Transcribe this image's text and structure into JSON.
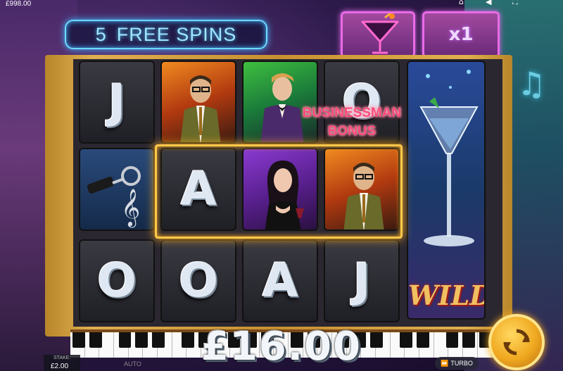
{
  "header": {
    "balance": "£998.00",
    "icons": [
      "home-icon",
      "sound-icon",
      "fullscreen-icon"
    ]
  },
  "free_spins": {
    "count": "5",
    "label": "FREE SPINS"
  },
  "multiplier": "x1",
  "bonus_label": {
    "line1": "BUSINESSMAN",
    "line2": "BONUS"
  },
  "reels": [
    [
      "J",
      "car-keys-treble-clef",
      "O"
    ],
    [
      "businessman-portrait",
      "A",
      "O"
    ],
    [
      "bellhop-portrait",
      "singer-portrait",
      "A"
    ],
    [
      "O",
      "businessman-portrait",
      "J"
    ]
  ],
  "wild": {
    "label": "WILD",
    "symbol": "martini-glass"
  },
  "win_amount": "£16.00",
  "footer": {
    "stake_label": "STAKE:",
    "stake_value": "£2.00",
    "auto_label": "AUTO",
    "turbo_label": "TURBO"
  },
  "colors": {
    "neon_blue": "#6fd8ff",
    "neon_pink": "#e86be8",
    "highlight_gold": "#ffc84a",
    "bonus_red": "#ff4a7a",
    "wild_gold": "#f0c060"
  }
}
